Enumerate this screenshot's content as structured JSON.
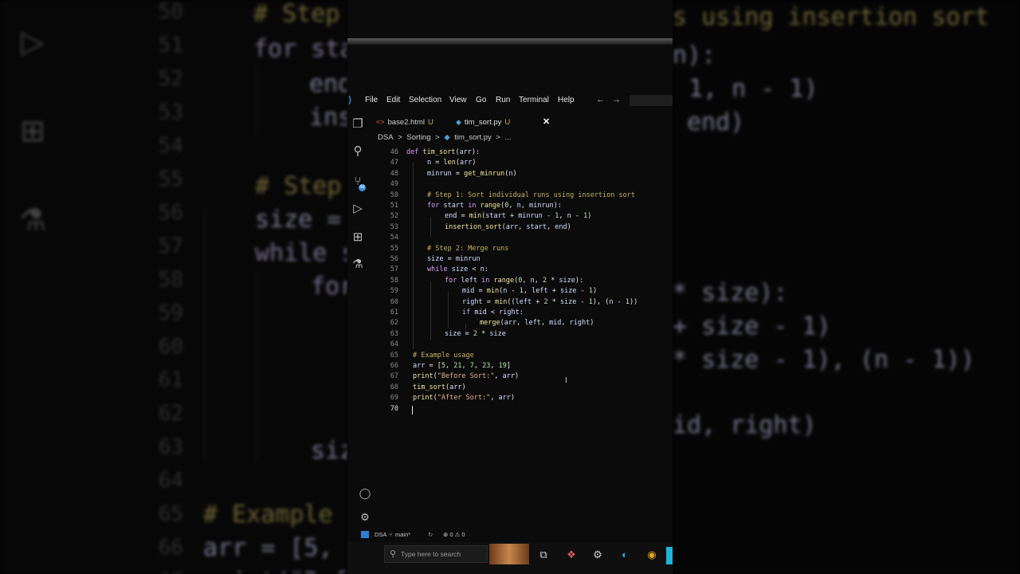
{
  "background": {
    "left_line_numbers": [
      "50",
      "51",
      "52",
      "53",
      "54",
      "55",
      "56",
      "57",
      "58",
      "59",
      "60",
      "61",
      "62",
      "63",
      "64",
      "65",
      "66",
      "67"
    ],
    "left_code": [
      {
        "text": "# Step",
        "color": "#c7b460"
      },
      {
        "text": "for sta",
        "color": "#d7c8ff"
      },
      {
        "text": "end",
        "color": "#d7d7ff"
      },
      {
        "text": "ins",
        "color": "#d7d7ff"
      },
      {
        "text": "# Step",
        "color": "#c7b460"
      },
      {
        "text": "size =",
        "color": "#d7d7ff"
      },
      {
        "text": "while s",
        "color": "#d7c8ff"
      },
      {
        "text": "for",
        "color": "#d7c8ff"
      },
      {
        "text": "siz",
        "color": "#d7d7ff"
      },
      {
        "text": "# Example u",
        "color": "#c7b460"
      },
      {
        "text": "arr = [5, 2",
        "color": "#d7d7ff"
      },
      {
        "text": "print(\"Befo",
        "color": "#d7d7ff"
      }
    ],
    "right_code": [
      {
        "text": "s using insertion sort",
        "color": "#c7b460"
      },
      {
        "text": "n):",
        "color": "#d7d7ff"
      },
      {
        "text": "1, n - 1)",
        "color": "#d7d7ff"
      },
      {
        "text": "end)",
        "color": "#d7d7ff"
      },
      {
        "text": "* size):",
        "color": "#d7d7ff"
      },
      {
        "text": "+ size - 1)",
        "color": "#d7d7ff"
      },
      {
        "text": "* size - 1), (n - 1))",
        "color": "#d7d7ff"
      },
      {
        "text": "id, right)",
        "color": "#d7d7ff"
      }
    ]
  },
  "menubar": {
    "items": [
      "File",
      "Edit",
      "Selection",
      "View",
      "Go",
      "Run",
      "Terminal",
      "Help"
    ],
    "back_arrow": "←",
    "forward_arrow": "→"
  },
  "tabs": [
    {
      "name": "base2.html",
      "modified": "U",
      "icon": "<>"
    },
    {
      "name": "tim_sort.py",
      "modified": "U",
      "icon": "◆",
      "active": true
    }
  ],
  "breadcrumbs": {
    "items": [
      "DSA",
      ">",
      "Sorting",
      ">",
      "tim_sort.py",
      ">",
      "..."
    ]
  },
  "editor": {
    "lines": [
      {
        "n": "46",
        "text": "def tim_sort(arr):",
        "indent": 0
      },
      {
        "n": "47",
        "text": "n = len(arr)",
        "indent": 1
      },
      {
        "n": "48",
        "text": "minrun = get_minrun(n)",
        "indent": 1
      },
      {
        "n": "49",
        "text": "",
        "indent": 1
      },
      {
        "n": "50",
        "text": "# Step 1: Sort individual runs using insertion sort",
        "indent": 1,
        "comment": true
      },
      {
        "n": "51",
        "text": "for start in range(0, n, minrun):",
        "indent": 1
      },
      {
        "n": "52",
        "text": "end = min(start + minrun - 1, n - 1)",
        "indent": 2
      },
      {
        "n": "53",
        "text": "insertion_sort(arr, start, end)",
        "indent": 2
      },
      {
        "n": "54",
        "text": "",
        "indent": 1
      },
      {
        "n": "55",
        "text": "# Step 2: Merge runs",
        "indent": 1,
        "comment": true
      },
      {
        "n": "56",
        "text": "size = minrun",
        "indent": 1
      },
      {
        "n": "57",
        "text": "while size < n:",
        "indent": 1
      },
      {
        "n": "58",
        "text": "for left in range(0, n, 2 * size):",
        "indent": 2
      },
      {
        "n": "59",
        "text": "mid = min(n - 1, left + size - 1)",
        "indent": 3
      },
      {
        "n": "60",
        "text": "right = min((left + 2 * size - 1), (n - 1))",
        "indent": 3
      },
      {
        "n": "61",
        "text": "if mid < right:",
        "indent": 3
      },
      {
        "n": "62",
        "text": "merge(arr, left, mid, right)",
        "indent": 4
      },
      {
        "n": "63",
        "text": "size = 2 * size",
        "indent": 2
      },
      {
        "n": "64",
        "text": "",
        "indent": 0
      },
      {
        "n": "65",
        "text": "# Example usage",
        "indent": 0,
        "comment": true
      },
      {
        "n": "66",
        "text": "arr = [5, 21, 7, 23, 19]",
        "indent": 0
      },
      {
        "n": "67",
        "text": "print(\"Before Sort:\", arr)",
        "indent": 0
      },
      {
        "n": "68",
        "text": "tim_sort(arr)",
        "indent": 0
      },
      {
        "n": "69",
        "text": "print(\"After Sort:\", arr)",
        "indent": 0
      },
      {
        "n": "70",
        "text": "",
        "indent": 0,
        "current": true
      }
    ]
  },
  "activity_badge": "48",
  "statusbar": {
    "workspace": "DSA",
    "branch": "main*",
    "problems": "⊗ 0 ⚠ 0"
  },
  "taskbar": {
    "search_placeholder": "Type here to search"
  },
  "colors": {
    "keyword": "#d7a0ff",
    "function": "#f5e8a0",
    "comment": "#c7b460",
    "variable": "#cfe0ff",
    "number": "#b8e6b0",
    "string": "#e6b48a",
    "accent": "#3b8fd9"
  }
}
